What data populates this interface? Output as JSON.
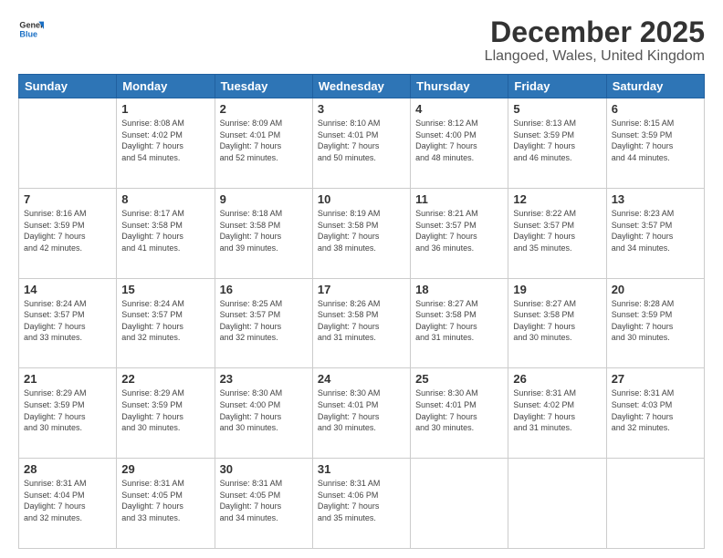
{
  "logo": {
    "text_general": "General",
    "text_blue": "Blue"
  },
  "header": {
    "title": "December 2025",
    "subtitle": "Llangoed, Wales, United Kingdom"
  },
  "days_of_week": [
    "Sunday",
    "Monday",
    "Tuesday",
    "Wednesday",
    "Thursday",
    "Friday",
    "Saturday"
  ],
  "weeks": [
    [
      {
        "day": "",
        "info": ""
      },
      {
        "day": "1",
        "info": "Sunrise: 8:08 AM\nSunset: 4:02 PM\nDaylight: 7 hours\nand 54 minutes."
      },
      {
        "day": "2",
        "info": "Sunrise: 8:09 AM\nSunset: 4:01 PM\nDaylight: 7 hours\nand 52 minutes."
      },
      {
        "day": "3",
        "info": "Sunrise: 8:10 AM\nSunset: 4:01 PM\nDaylight: 7 hours\nand 50 minutes."
      },
      {
        "day": "4",
        "info": "Sunrise: 8:12 AM\nSunset: 4:00 PM\nDaylight: 7 hours\nand 48 minutes."
      },
      {
        "day": "5",
        "info": "Sunrise: 8:13 AM\nSunset: 3:59 PM\nDaylight: 7 hours\nand 46 minutes."
      },
      {
        "day": "6",
        "info": "Sunrise: 8:15 AM\nSunset: 3:59 PM\nDaylight: 7 hours\nand 44 minutes."
      }
    ],
    [
      {
        "day": "7",
        "info": "Sunrise: 8:16 AM\nSunset: 3:59 PM\nDaylight: 7 hours\nand 42 minutes."
      },
      {
        "day": "8",
        "info": "Sunrise: 8:17 AM\nSunset: 3:58 PM\nDaylight: 7 hours\nand 41 minutes."
      },
      {
        "day": "9",
        "info": "Sunrise: 8:18 AM\nSunset: 3:58 PM\nDaylight: 7 hours\nand 39 minutes."
      },
      {
        "day": "10",
        "info": "Sunrise: 8:19 AM\nSunset: 3:58 PM\nDaylight: 7 hours\nand 38 minutes."
      },
      {
        "day": "11",
        "info": "Sunrise: 8:21 AM\nSunset: 3:57 PM\nDaylight: 7 hours\nand 36 minutes."
      },
      {
        "day": "12",
        "info": "Sunrise: 8:22 AM\nSunset: 3:57 PM\nDaylight: 7 hours\nand 35 minutes."
      },
      {
        "day": "13",
        "info": "Sunrise: 8:23 AM\nSunset: 3:57 PM\nDaylight: 7 hours\nand 34 minutes."
      }
    ],
    [
      {
        "day": "14",
        "info": "Sunrise: 8:24 AM\nSunset: 3:57 PM\nDaylight: 7 hours\nand 33 minutes."
      },
      {
        "day": "15",
        "info": "Sunrise: 8:24 AM\nSunset: 3:57 PM\nDaylight: 7 hours\nand 32 minutes."
      },
      {
        "day": "16",
        "info": "Sunrise: 8:25 AM\nSunset: 3:57 PM\nDaylight: 7 hours\nand 32 minutes."
      },
      {
        "day": "17",
        "info": "Sunrise: 8:26 AM\nSunset: 3:58 PM\nDaylight: 7 hours\nand 31 minutes."
      },
      {
        "day": "18",
        "info": "Sunrise: 8:27 AM\nSunset: 3:58 PM\nDaylight: 7 hours\nand 31 minutes."
      },
      {
        "day": "19",
        "info": "Sunrise: 8:27 AM\nSunset: 3:58 PM\nDaylight: 7 hours\nand 30 minutes."
      },
      {
        "day": "20",
        "info": "Sunrise: 8:28 AM\nSunset: 3:59 PM\nDaylight: 7 hours\nand 30 minutes."
      }
    ],
    [
      {
        "day": "21",
        "info": "Sunrise: 8:29 AM\nSunset: 3:59 PM\nDaylight: 7 hours\nand 30 minutes."
      },
      {
        "day": "22",
        "info": "Sunrise: 8:29 AM\nSunset: 3:59 PM\nDaylight: 7 hours\nand 30 minutes."
      },
      {
        "day": "23",
        "info": "Sunrise: 8:30 AM\nSunset: 4:00 PM\nDaylight: 7 hours\nand 30 minutes."
      },
      {
        "day": "24",
        "info": "Sunrise: 8:30 AM\nSunset: 4:01 PM\nDaylight: 7 hours\nand 30 minutes."
      },
      {
        "day": "25",
        "info": "Sunrise: 8:30 AM\nSunset: 4:01 PM\nDaylight: 7 hours\nand 30 minutes."
      },
      {
        "day": "26",
        "info": "Sunrise: 8:31 AM\nSunset: 4:02 PM\nDaylight: 7 hours\nand 31 minutes."
      },
      {
        "day": "27",
        "info": "Sunrise: 8:31 AM\nSunset: 4:03 PM\nDaylight: 7 hours\nand 32 minutes."
      }
    ],
    [
      {
        "day": "28",
        "info": "Sunrise: 8:31 AM\nSunset: 4:04 PM\nDaylight: 7 hours\nand 32 minutes."
      },
      {
        "day": "29",
        "info": "Sunrise: 8:31 AM\nSunset: 4:05 PM\nDaylight: 7 hours\nand 33 minutes."
      },
      {
        "day": "30",
        "info": "Sunrise: 8:31 AM\nSunset: 4:05 PM\nDaylight: 7 hours\nand 34 minutes."
      },
      {
        "day": "31",
        "info": "Sunrise: 8:31 AM\nSunset: 4:06 PM\nDaylight: 7 hours\nand 35 minutes."
      },
      {
        "day": "",
        "info": ""
      },
      {
        "day": "",
        "info": ""
      },
      {
        "day": "",
        "info": ""
      }
    ]
  ]
}
